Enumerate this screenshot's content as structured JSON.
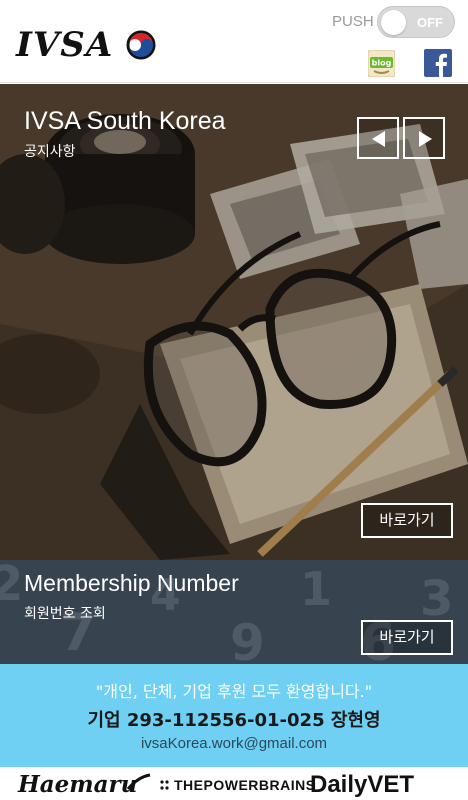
{
  "header": {
    "logo_text": "IVSA",
    "push_label": "PUSH",
    "toggle_state": "OFF",
    "blog_label": "blog"
  },
  "hero": {
    "title": "IVSA South Korea",
    "subtitle": "공지사항",
    "go_label": "바로가기"
  },
  "membership": {
    "title": "Membership Number",
    "subtitle": "회원번호 조회",
    "go_label": "바로가기"
  },
  "donate": {
    "line1": "\"개인, 단체, 기업 후원 모두 환영합니다.\"",
    "line2": "기업 293-112556-01-025 장현영",
    "email": "ivsaKorea.work@gmail.com"
  },
  "footer": {
    "sponsor1": "Haemaru",
    "sponsor2": "THEPOWERBRAINS",
    "sponsor3": "DailyVET"
  },
  "colors": {
    "banner_bg": "#6fd0f4",
    "toggle_bg": "#d9d9d9",
    "facebook": "#3b5998"
  }
}
